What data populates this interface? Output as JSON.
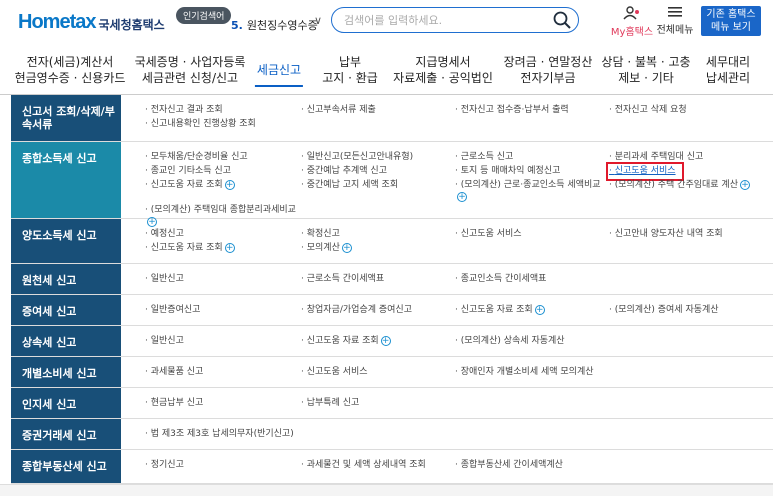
{
  "header": {
    "brand": "Hometax",
    "brand_sup": "국세청 홈택스",
    "org": "국세청홈택스",
    "popular_label": "인기검색어",
    "rank_num": "5.",
    "rank_text": "원천징수영수증",
    "search_placeholder": "검색어를 입력하세요.",
    "mytax": "My홈택스",
    "allmenu": "전체메뉴",
    "oldmenu_line1": "기존 홈택스",
    "oldmenu_line2": "메뉴 보기"
  },
  "nav": [
    {
      "l1": "전자(세금)계산서",
      "l2": "현금영수증 · 신용카드"
    },
    {
      "l1": "국세증명 · 사업자등록",
      "l2": "세금관련 신청/신고"
    },
    {
      "l1": "세금신고",
      "l2": ""
    },
    {
      "l1": "납부",
      "l2": "고지 · 환급"
    },
    {
      "l1": "지급명세서",
      "l2": "자료제출 · 공익법인"
    },
    {
      "l1": "장려금 · 연말정산",
      "l2": "전자기부금"
    },
    {
      "l1": "상담 · 불복 · 고충",
      "l2": "제보 · 기타"
    },
    {
      "l1": "세무대리",
      "l2": "납세관리"
    }
  ],
  "rows": [
    {
      "head": "신고서 조회/삭제/부속서류",
      "items": [
        "전자신고 결과 조회",
        "신고부속서류 제출",
        "전자신고 접수증·납부서 출력",
        "전자신고 삭제 요청",
        "신고내용확인 진행상황 조회"
      ]
    },
    {
      "head": "종합소득세 신고",
      "items": [
        "모두채움/단순경비율 신고",
        "일반신고(모든신고안내유형)",
        "근로소득 신고",
        "분리과세 주택임대 신고",
        "종교인 기타소득 신고",
        "중간예납 추계액 신고",
        "토지 등 매매차익 예정신고",
        "신고도움 서비스",
        "신고도움 자료 조회",
        "중간예납 고지 세액 조회",
        "(모의계산) 근로·종교인소득 세액비교",
        "(모의계산) 주택 간주임대료 계산",
        "(모의계산) 주택임대 종합분리과세비교"
      ]
    },
    {
      "head": "양도소득세 신고",
      "items": [
        "예정신고",
        "확정신고",
        "신고도움 서비스",
        "신고안내 양도자산 내역 조회",
        "신고도움 자료 조회",
        "모의계산"
      ]
    },
    {
      "head": "원천세 신고",
      "items": [
        "일반신고",
        "근로소득 간이세액표",
        "종교인소득 간이세액표"
      ]
    },
    {
      "head": "증여세 신고",
      "items": [
        "일반증여신고",
        "창업자금/가업승계 증여신고",
        "신고도움 자료 조회",
        "(모의계산) 증여세 자동계산"
      ]
    },
    {
      "head": "상속세 신고",
      "items": [
        "일반신고",
        "신고도움 자료 조회",
        "(모의계산) 상속세 자동계산"
      ]
    },
    {
      "head": "개별소비세 신고",
      "items": [
        "과세물품 신고",
        "신고도움 서비스",
        "장애인자 개별소비세 세액 모의계산"
      ]
    },
    {
      "head": "인지세 신고",
      "items": [
        "현금납부 신고",
        "납부특례 신고"
      ]
    },
    {
      "head": "증권거래세 신고",
      "items": [
        "법 제3조 제3호 납세의무자(반기신고)"
      ]
    },
    {
      "head": "종합부동산세 신고",
      "items": [
        "정기신고",
        "과세물건 및 세액 상세내역 조회",
        "종합부동산세 간이세액계산"
      ]
    }
  ],
  "colors": {
    "row_head": "#184f78",
    "row_head_active": "#1b8aa8",
    "accent": "#0a5fc5",
    "highlight_box": "#e0192c"
  }
}
